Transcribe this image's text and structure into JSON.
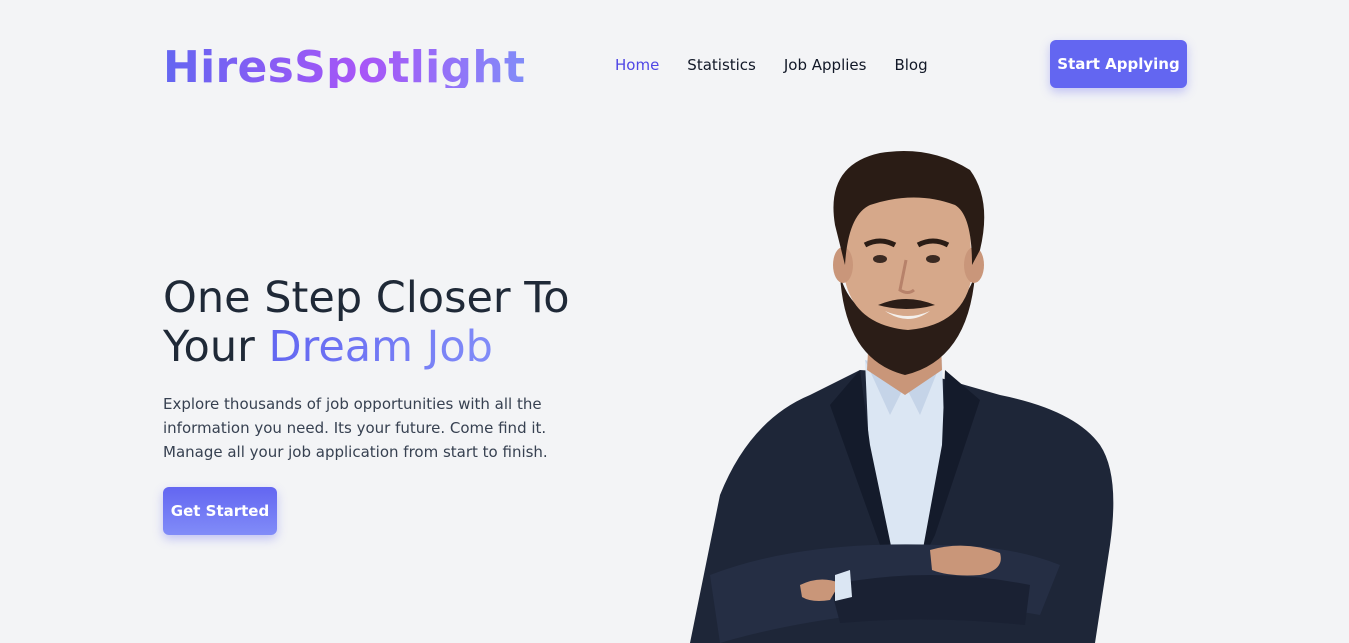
{
  "brand": {
    "name": "HiresSpotlight"
  },
  "nav": {
    "items": [
      {
        "label": "Home",
        "active": true
      },
      {
        "label": "Statistics",
        "active": false
      },
      {
        "label": "Job Applies",
        "active": false
      },
      {
        "label": "Blog",
        "active": false
      }
    ],
    "cta_label": "Start Applying"
  },
  "hero": {
    "title_line1": "One Step Closer To",
    "title_prefix": "Your ",
    "title_accent": "Dream Job",
    "description": "Explore thousands of job opportunities with all the information you need. Its your future. Come find it. Manage all your job application from start to finish.",
    "button_label": "Get Started"
  },
  "colors": {
    "accent": "#6366f1",
    "accent_light": "#818cf8",
    "logo_purple": "#a855f7",
    "background": "#f3f4f6",
    "text_dark": "#1f2937"
  }
}
